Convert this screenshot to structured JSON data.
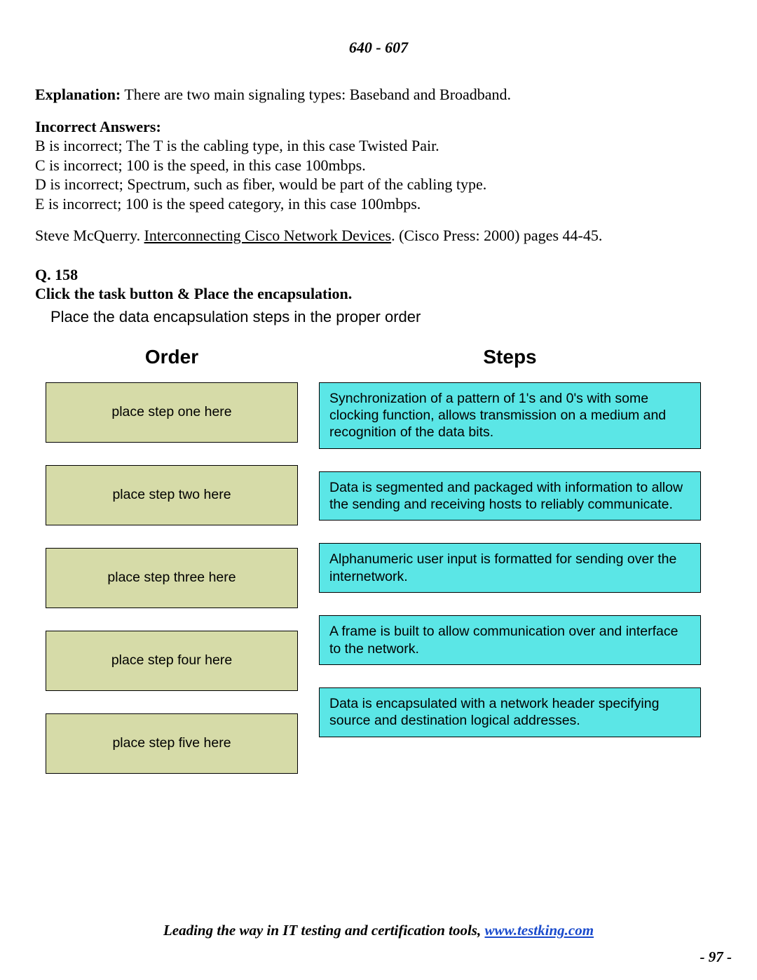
{
  "header": {
    "code": "640 - 607"
  },
  "explanation": {
    "label": "Explanation:",
    "text": " There are two main signaling types: Baseband and Broadband."
  },
  "incorrect": {
    "label": "Incorrect Answers:",
    "lines": [
      "B is incorrect; The T is the cabling type, in this case Twisted Pair.",
      "C is incorrect; 100 is the speed, in this case 100mbps.",
      "D is incorrect; Spectrum, such as fiber, would be part of the cabling type.",
      "E is incorrect; 100 is the speed category, in this case 100mbps."
    ]
  },
  "reference": {
    "author": "Steve McQuerry.  ",
    "title": "Interconnecting Cisco Network Devices",
    "tail": ". (Cisco Press: 2000) pages  44-45."
  },
  "question": {
    "number": "Q. 158",
    "prompt": "Click the task button & Place the encapsulation.",
    "instruction": "Place the data encapsulation steps in the proper order"
  },
  "columns": {
    "order_header": "Order",
    "steps_header": "Steps",
    "order_slots": [
      "place step one here",
      "place step two here",
      "place step three here",
      "place step four here",
      "place step five here"
    ],
    "steps": [
      "Synchronization of a pattern of 1's and 0's with some clocking function, allows transmission on a medium and recognition of the data bits.",
      "Data is segmented and packaged with information to allow the sending and receiving hosts to reliably communicate.",
      "Alphanumeric user input is formatted for sending over the internetwork.",
      "A frame is built to allow communication over and interface to the network.",
      "Data is encapsulated with a network header specifying source and destination logical addresses."
    ]
  },
  "footer": {
    "lead": "Leading the way in IT testing and certification tools, ",
    "link_text": "www.testking.com",
    "page": "- 97 -"
  }
}
